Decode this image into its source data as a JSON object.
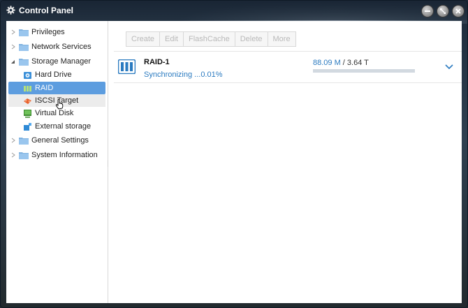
{
  "window": {
    "title": "Control Panel"
  },
  "sidebar": {
    "items": [
      {
        "label": "Privileges"
      },
      {
        "label": "Network Services"
      },
      {
        "label": "Storage Manager"
      },
      {
        "label": "Hard Drive"
      },
      {
        "label": "RAID"
      },
      {
        "label": "ISCSI Target"
      },
      {
        "label": "Virtual Disk"
      },
      {
        "label": "External storage"
      },
      {
        "label": "General Settings"
      },
      {
        "label": "System Information"
      }
    ]
  },
  "toolbar": {
    "create_label": "Create",
    "edit_label": "Edit",
    "flashcache_label": "FlashCache",
    "delete_label": "Delete",
    "more_label": "More"
  },
  "raid": {
    "name": "RAID-1",
    "status": "Synchronizing ...0.01%",
    "used": "88.09 M",
    "total": " / 3.64 T",
    "usage_fraction": 0.0001
  },
  "colors": {
    "accent": "#2a7ac0",
    "selection": "#5d9ddf"
  },
  "icons": {
    "title": "gear-icon",
    "minimize": "minimize-icon",
    "maximize": "maximize-icon",
    "close": "close-icon",
    "folder": "folder-icon",
    "raid": "raid-array-icon",
    "expand": "chevron-down-icon"
  }
}
